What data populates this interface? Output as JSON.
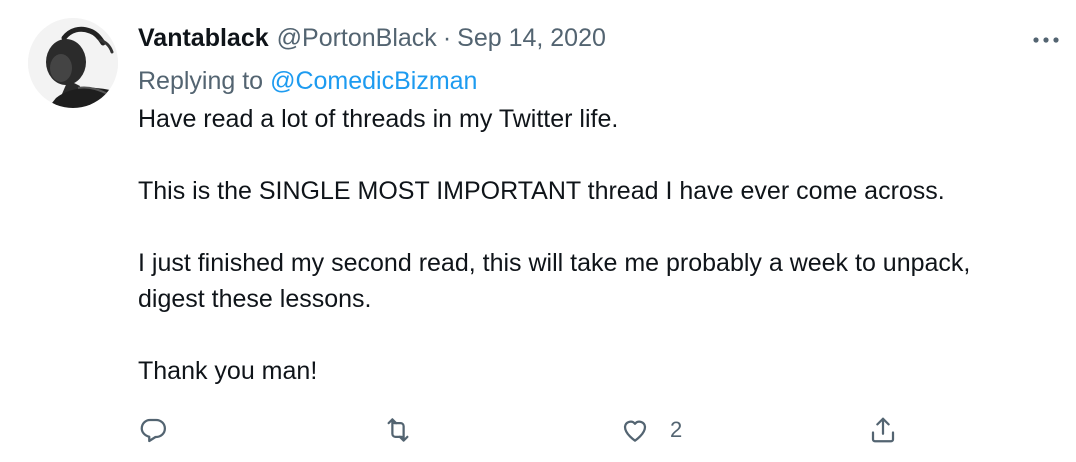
{
  "tweet": {
    "author": {
      "display_name": "Vantablack",
      "handle": "@PortonBlack",
      "separator": "·",
      "date": "Sep 14, 2020"
    },
    "replying_to": {
      "label": "Replying to",
      "target": "@ComedicBizman"
    },
    "paragraphs": [
      [
        "Have read a lot of threads in my Twitter life."
      ],
      [
        "This is the SINGLE MOST IMPORTANT thread I have ever come across."
      ],
      [
        "I just finished my second read, this will take me probably a week to unpack,",
        "digest these lessons."
      ],
      [
        "Thank you man!"
      ]
    ],
    "actions": {
      "reply_icon": "reply-icon",
      "retweet_icon": "retweet-icon",
      "like_icon": "heart-icon",
      "like_count": "2",
      "share_icon": "share-icon"
    },
    "more_icon": "more-icon"
  },
  "colors": {
    "text": "#0f1419",
    "secondary": "#536471",
    "link": "#1d9bf0",
    "background": "#ffffff"
  }
}
